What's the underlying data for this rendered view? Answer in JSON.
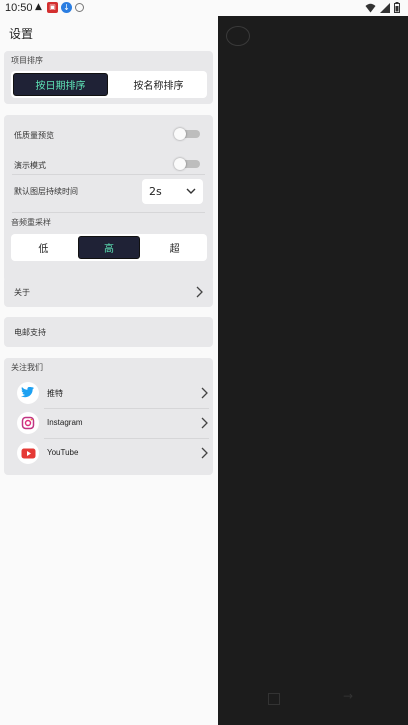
{
  "status_bar": {
    "time": "10:50"
  },
  "drawer": {
    "title": "设置",
    "sort_section": {
      "label": "项目排序",
      "options": [
        "按日期排序",
        "按名称排序"
      ],
      "selected": "按日期排序"
    },
    "settings": {
      "low_quality_preview": {
        "label": "低质量预览",
        "on": false
      },
      "demo_mode": {
        "label": "演示模式",
        "on": false
      },
      "default_layer_duration": {
        "label": "默认图层持续时间",
        "value": "2s"
      },
      "audio_resample": {
        "label": "音频重采样",
        "options": [
          "低",
          "高",
          "超"
        ],
        "selected": "高"
      }
    },
    "about_label": "关于",
    "email_support_label": "电邮支持",
    "follow": {
      "label": "关注我们",
      "items": [
        {
          "label": "推特",
          "icon": "twitter-icon",
          "color": "#1da1f2"
        },
        {
          "label": "Instagram",
          "icon": "instagram-icon",
          "color": "#c13584"
        },
        {
          "label": "YouTube",
          "icon": "youtube-icon",
          "color": "#e53935"
        }
      ]
    }
  },
  "colors": {
    "accent_dark": "#1f2236",
    "accent_text": "#5fe6b8",
    "card_bg": "#e8e8ea"
  }
}
